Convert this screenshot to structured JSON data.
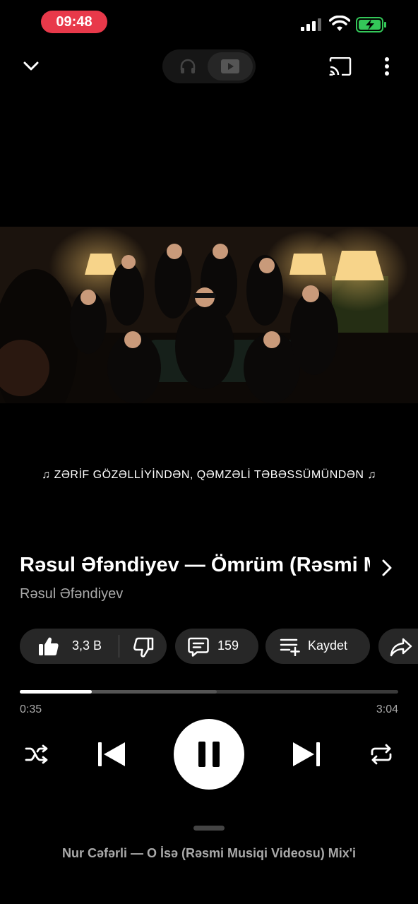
{
  "status_bar": {
    "time": "09:48",
    "icons": [
      "signal-icon",
      "wifi-icon",
      "battery-charging-icon"
    ],
    "battery_color": "#34c759"
  },
  "top_bar": {
    "icons": [
      "chevron-down-icon",
      "headphones-icon",
      "video-icon",
      "cast-icon",
      "more-vertical-icon"
    ],
    "selected_mode": "video"
  },
  "video": {
    "lyric": "♫ ZƏRİF GÖZƏLLİYİNDƏN, QƏMZƏLİ TƏBƏSSÜMÜNDƏN ♫"
  },
  "track": {
    "title": "Rəsul Əfəndiyev — Ömrüm (Rəsmi Musiqi Videosu)",
    "artist": "Rəsul Əfəndiyev"
  },
  "actions": {
    "likes": "3,3 B",
    "comments": "159",
    "save_label": "Kaydet",
    "icons": [
      "thumbs-up-icon",
      "thumbs-down-icon",
      "comment-icon",
      "playlist-add-icon",
      "share-icon"
    ]
  },
  "progress": {
    "current": "0:35",
    "total": "3:04",
    "played_fraction": 0.19,
    "buffered_fraction": 0.52
  },
  "controls": {
    "icons": [
      "shuffle-icon",
      "skip-previous-icon",
      "pause-icon",
      "skip-next-icon",
      "repeat-icon"
    ]
  },
  "up_next": "Nur Cəfərli — O İsə (Rəsmi Musiqi Videosu) Mix'i",
  "colors": {
    "background": "#000000",
    "chip": "#272727",
    "status_pill": "#e8394a"
  }
}
